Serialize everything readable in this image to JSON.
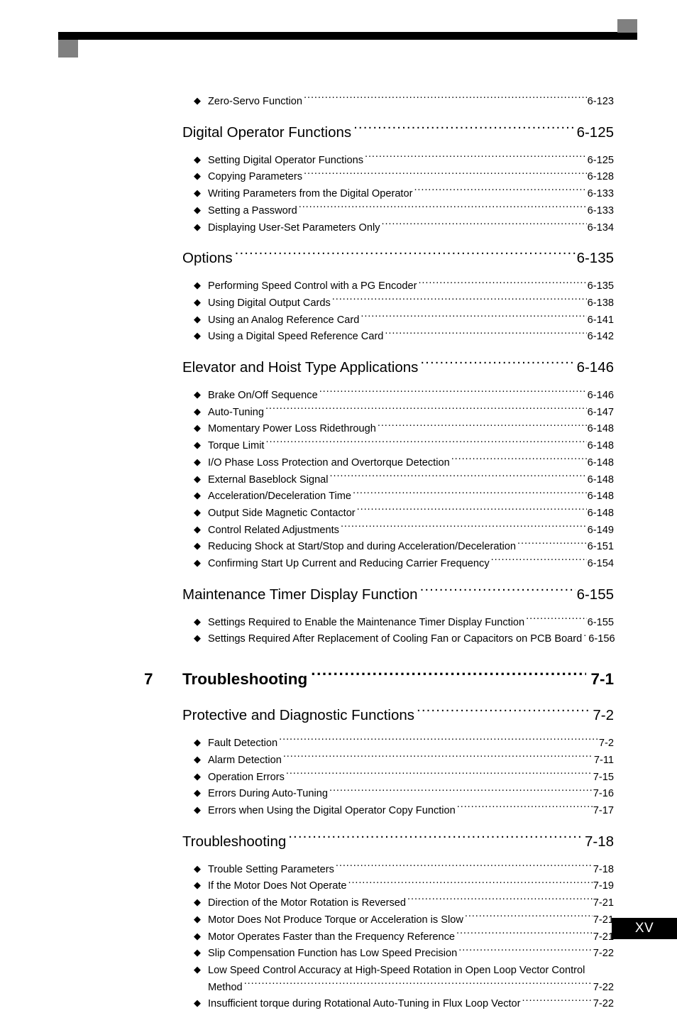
{
  "page": {
    "folio": "XV",
    "bullet_glyph": "◆"
  },
  "decor": {
    "rule_color": "#000000",
    "square_color": "#808080"
  },
  "toc": {
    "blocks": [
      {
        "type": "entry",
        "label": "Zero-Servo Function",
        "pageno": "6-123"
      },
      {
        "type": "section",
        "label": "Digital Operator Functions",
        "pageno": "6-125"
      },
      {
        "type": "entry",
        "label": "Setting Digital Operator Functions",
        "pageno": "6-125"
      },
      {
        "type": "entry",
        "label": "Copying Parameters",
        "pageno": "6-128"
      },
      {
        "type": "entry",
        "label": "Writing Parameters from the Digital Operator",
        "pageno": "6-133"
      },
      {
        "type": "entry",
        "label": "Setting a Password",
        "pageno": "6-133"
      },
      {
        "type": "entry",
        "label": "Displaying User-Set Parameters Only",
        "pageno": "6-134"
      },
      {
        "type": "section",
        "label": "Options",
        "pageno": "6-135"
      },
      {
        "type": "entry",
        "label": "Performing Speed Control with a PG Encoder",
        "pageno": "6-135"
      },
      {
        "type": "entry",
        "label": "Using Digital Output Cards",
        "pageno": "6-138"
      },
      {
        "type": "entry",
        "label": "Using an Analog Reference Card",
        "pageno": "6-141"
      },
      {
        "type": "entry",
        "label": "Using a Digital Speed Reference Card",
        "pageno": "6-142"
      },
      {
        "type": "section",
        "label": "Elevator and Hoist Type Applications",
        "pageno": "6-146"
      },
      {
        "type": "entry",
        "label": "Brake On/Off Sequence",
        "pageno": "6-146"
      },
      {
        "type": "entry",
        "label": "Auto-Tuning",
        "pageno": "6-147"
      },
      {
        "type": "entry",
        "label": "Momentary Power Loss Ridethrough",
        "pageno": "6-148"
      },
      {
        "type": "entry",
        "label": "Torque Limit",
        "pageno": "6-148"
      },
      {
        "type": "entry",
        "label": "I/O Phase Loss Protection and Overtorque Detection",
        "pageno": "6-148"
      },
      {
        "type": "entry",
        "label": "External Baseblock Signal",
        "pageno": "6-148"
      },
      {
        "type": "entry",
        "label": "Acceleration/Deceleration Time",
        "pageno": "6-148"
      },
      {
        "type": "entry",
        "label": "Output Side Magnetic Contactor",
        "pageno": "6-148"
      },
      {
        "type": "entry",
        "label": "Control Related Adjustments",
        "pageno": "6-149"
      },
      {
        "type": "entry",
        "label": "Reducing Shock at Start/Stop and during Acceleration/Deceleration",
        "pageno": "6-151"
      },
      {
        "type": "entry",
        "label": "Confirming Start Up Current and Reducing Carrier Frequency",
        "pageno": "6-154"
      },
      {
        "type": "section",
        "label": "Maintenance Timer Display Function",
        "pageno": "6-155"
      },
      {
        "type": "entry",
        "label": "Settings Required to Enable the Maintenance Timer Display Function",
        "pageno": "6-155"
      },
      {
        "type": "entry",
        "label": "Settings Required After Replacement of Cooling Fan or Capacitors on PCB Board",
        "pageno": "6-156"
      },
      {
        "type": "chapter",
        "num": "7",
        "label": "Troubleshooting",
        "pageno": "7-1"
      },
      {
        "type": "section",
        "label": "Protective and Diagnostic Functions",
        "pageno": "7-2"
      },
      {
        "type": "entry",
        "label": "Fault Detection",
        "pageno": "7-2"
      },
      {
        "type": "entry",
        "label": "Alarm Detection",
        "pageno": "7-11"
      },
      {
        "type": "entry",
        "label": "Operation Errors",
        "pageno": "7-15"
      },
      {
        "type": "entry",
        "label": " Errors During Auto-Tuning",
        "pageno": "7-16"
      },
      {
        "type": "entry",
        "label": "Errors when Using the Digital Operator Copy Function",
        "pageno": "7-17"
      },
      {
        "type": "section",
        "label": "Troubleshooting",
        "pageno": "7-18"
      },
      {
        "type": "entry",
        "label": "Trouble Setting Parameters",
        "pageno": "7-18"
      },
      {
        "type": "entry",
        "label": "If the Motor Does Not Operate",
        "pageno": "7-19"
      },
      {
        "type": "entry",
        "label": "Direction of the Motor Rotation is Reversed",
        "pageno": "7-21"
      },
      {
        "type": "entry",
        "label": "Motor Does Not Produce Torque or Acceleration is Slow",
        "pageno": "7-21"
      },
      {
        "type": "entry",
        "label": "Motor Operates Faster than the Frequency Reference",
        "pageno": "7-21"
      },
      {
        "type": "entry",
        "label": "Slip Compensation Function has Low Speed Precision",
        "pageno": "7-22"
      },
      {
        "type": "entry-nowrap",
        "label": "Low Speed Control Accuracy at High-Speed Rotation in Open Loop Vector Control"
      },
      {
        "type": "entry-cont",
        "label": "Method",
        "pageno": "7-22"
      },
      {
        "type": "entry",
        "label": "Insufficient torque during Rotational Auto-Tuning in Flux Loop Vector",
        "pageno": "7-22"
      }
    ]
  }
}
